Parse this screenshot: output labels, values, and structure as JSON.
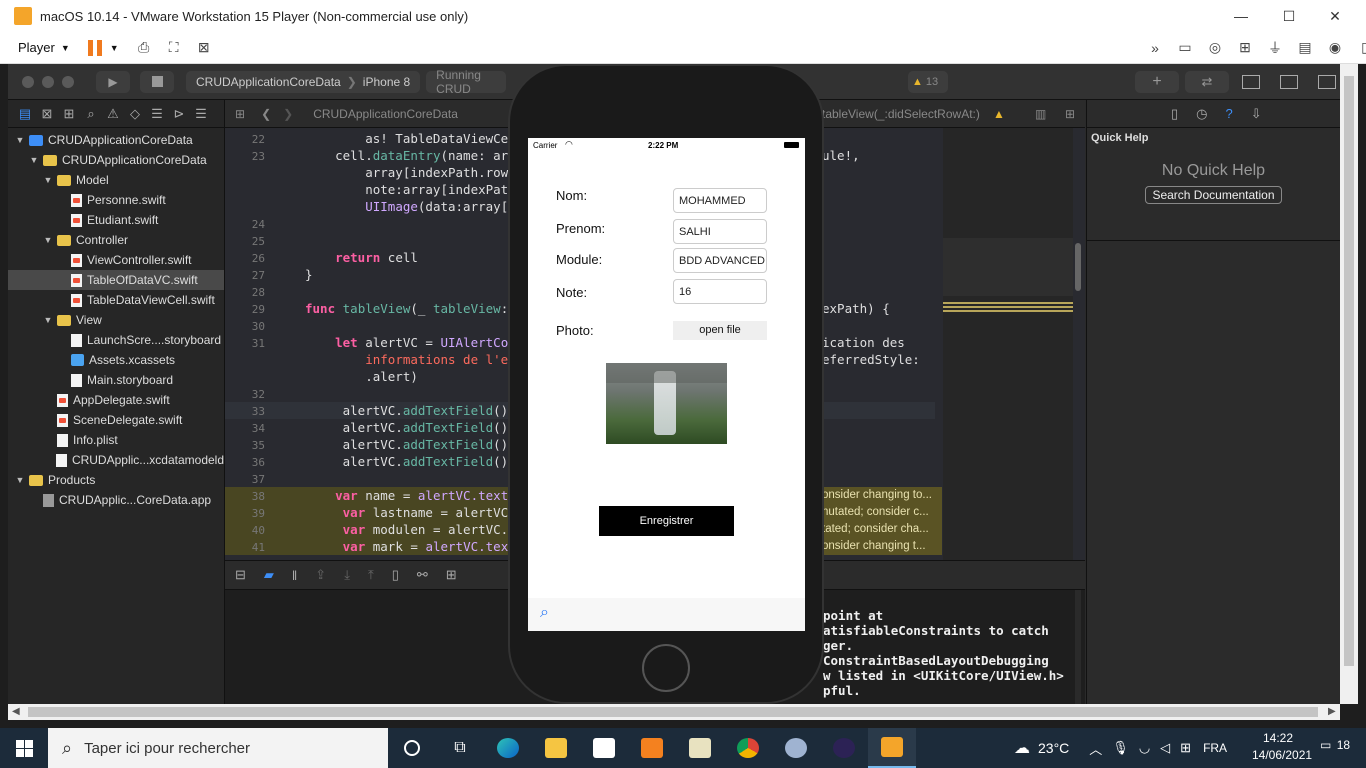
{
  "vmware": {
    "title": "macOS 10.14 - VMware Workstation 15 Player (Non-commercial use only)",
    "player_menu": "Player",
    "icons": [
      "pause-icon",
      "send-ctrl-alt-del-icon",
      "fullscreen-icon",
      "unity-icon"
    ],
    "device_icons": [
      "chevron-right-icon",
      "hdd-icon",
      "cd-icon",
      "network-icon",
      "usb-icon",
      "printer-icon",
      "sound-icon",
      "message-icon"
    ]
  },
  "xcode": {
    "scheme": "CRUDApplicationCoreData",
    "device": "iPhone 8",
    "status": "Running CRUD",
    "warning_count": "13",
    "breadcrumb_file": "CRUDApplicationCoreData",
    "breadcrumb_method": "tableView(_:didSelectRowAt:)"
  },
  "navigator": {
    "items": [
      {
        "label": "CRUDApplicationCoreData",
        "indent": 0,
        "kind": "project",
        "open": true
      },
      {
        "label": "CRUDApplicationCoreData",
        "indent": 1,
        "kind": "folder",
        "open": true
      },
      {
        "label": "Model",
        "indent": 2,
        "kind": "folder",
        "open": true
      },
      {
        "label": "Personne.swift",
        "indent": 3,
        "kind": "swift"
      },
      {
        "label": "Etudiant.swift",
        "indent": 3,
        "kind": "swift"
      },
      {
        "label": "Controller",
        "indent": 2,
        "kind": "folder",
        "open": true
      },
      {
        "label": "ViewController.swift",
        "indent": 3,
        "kind": "swift"
      },
      {
        "label": "TableOfDataVC.swift",
        "indent": 3,
        "kind": "swift",
        "selected": true
      },
      {
        "label": "TableDataViewCell.swift",
        "indent": 3,
        "kind": "swift"
      },
      {
        "label": "View",
        "indent": 2,
        "kind": "folder",
        "open": true
      },
      {
        "label": "LaunchScre....storyboard",
        "indent": 3,
        "kind": "doc"
      },
      {
        "label": "Assets.xcassets",
        "indent": 3,
        "kind": "asset"
      },
      {
        "label": "Main.storyboard",
        "indent": 3,
        "kind": "doc"
      },
      {
        "label": "AppDelegate.swift",
        "indent": 2,
        "kind": "swift"
      },
      {
        "label": "SceneDelegate.swift",
        "indent": 2,
        "kind": "swift"
      },
      {
        "label": "Info.plist",
        "indent": 2,
        "kind": "doc"
      },
      {
        "label": "CRUDApplic...xcdatamodeld",
        "indent": 2,
        "kind": "doc"
      },
      {
        "label": "Products",
        "indent": 0,
        "kind": "folder",
        "open": true
      },
      {
        "label": "CRUDApplic...CoreData.app",
        "indent": 1,
        "kind": "app"
      }
    ]
  },
  "code_lines": [
    {
      "n": "22",
      "text": "        as! TableDataViewCell",
      "y": 0
    },
    {
      "n": "23",
      "text": "    cell.dataEntry(name: array[",
      "y": 1,
      "right": "ule!,"
    },
    {
      "n": "",
      "text": "        array[indexPath.row]",
      "y": 2
    },
    {
      "n": "",
      "text": "        note:array[indexPat",
      "y": 3
    },
    {
      "n": "",
      "text": "        UIImage(data:array[",
      "y": 4
    },
    {
      "n": "24",
      "text": "",
      "y": 5
    },
    {
      "n": "25",
      "text": "",
      "y": 6
    },
    {
      "n": "26",
      "text": "    return cell",
      "y": 7
    },
    {
      "n": "27",
      "text": "}",
      "y": 8
    },
    {
      "n": "28",
      "text": "",
      "y": 9
    },
    {
      "n": "29",
      "text": "func tableView(_ tableView:",
      "y": 10,
      "right": "exPath) {"
    },
    {
      "n": "30",
      "text": "",
      "y": 11
    },
    {
      "n": "31",
      "text": "    let alertVC = UIAlertCon",
      "y": 12,
      "right": "ication des"
    },
    {
      "n": "",
      "text": "        informations de l'et",
      "y": 13,
      "right": "eferredStyle:"
    },
    {
      "n": "",
      "text": "        .alert)",
      "y": 14
    },
    {
      "n": "32",
      "text": "",
      "y": 15
    },
    {
      "n": "33",
      "text": "     alertVC.addTextField()",
      "y": 16,
      "current": true
    },
    {
      "n": "34",
      "text": "     alertVC.addTextField()",
      "y": 17
    },
    {
      "n": "35",
      "text": "     alertVC.addTextField()",
      "y": 18
    },
    {
      "n": "36",
      "text": "     alertVC.addTextField()",
      "y": 19
    },
    {
      "n": "37",
      "text": "",
      "y": 20
    },
    {
      "n": "38",
      "text": "    var name = alertVC.textF",
      "y": 21,
      "warn": "onsider changing to..."
    },
    {
      "n": "39",
      "text": "     var lastname = alertVC.",
      "y": 22,
      "warn": "nutated; consider c..."
    },
    {
      "n": "40",
      "text": "     var modulen = alertVC.t",
      "y": 23,
      "warn": "tated; consider cha..."
    },
    {
      "n": "41",
      "text": "     var mark = alertVC.text",
      "y": 24,
      "warn": "onsider changing t..."
    }
  ],
  "console_lines": [
    "point at",
    "atisfiableConstraints to catch",
    "ger.",
    "ConstraintBasedLayoutDebugging",
    "w listed in <UIKitCore/UIView.h>",
    "pful."
  ],
  "inspector": {
    "title": "Quick Help",
    "empty_text": "No Quick Help",
    "search_button": "Search Documentation"
  },
  "simulator": {
    "carrier": "Carrier",
    "time": "2:22 PM",
    "form": {
      "nom_label": "Nom:",
      "nom_value": "MOHAMMED",
      "prenom_label": "Prenom:",
      "prenom_value": "SALHI",
      "module_label": "Module:",
      "module_value": "BDD ADVANCED",
      "note_label": "Note:",
      "note_value": "16",
      "photo_label": "Photo:",
      "open_file": "open file",
      "submit": "Enregistrer"
    }
  },
  "taskbar": {
    "search_placeholder": "Taper ici pour rechercher",
    "weather": "23°C",
    "language": "FRA",
    "time": "14:22",
    "date": "14/06/2021",
    "notifications": "18",
    "colors": {
      "taskbar": "#1c2b3a",
      "accent": "#0078d7"
    }
  }
}
